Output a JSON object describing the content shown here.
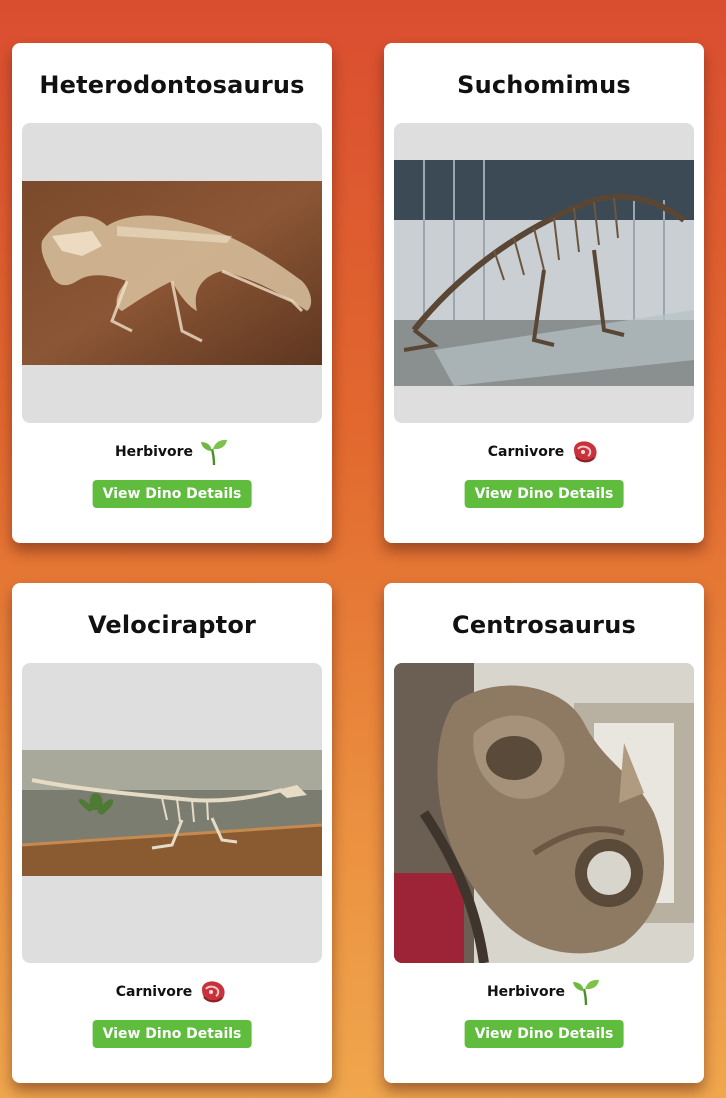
{
  "cards": [
    {
      "name": "Heterodontosaurus",
      "diet": "Herbivore",
      "diet_icon": "seedling-icon",
      "button_label": "View Dino Details",
      "photo": "fossil skeleton embedded in brown rock slab"
    },
    {
      "name": "Suchomimus",
      "diet": "Carnivore",
      "diet_icon": "meat-icon",
      "button_label": "View Dino Details",
      "photo": "mounted skeleton in glass museum atrium"
    },
    {
      "name": "Velociraptor",
      "diet": "Carnivore",
      "diet_icon": "meat-icon",
      "button_label": "View Dino Details",
      "photo": "skeleton on wooden display table"
    },
    {
      "name": "Centrosaurus",
      "diet": "Herbivore",
      "diet_icon": "seedling-icon",
      "button_label": "View Dino Details",
      "photo": "horned skull fossil close-up in museum"
    }
  ],
  "colors": {
    "button": "#5fbc3d",
    "card": "#ffffff",
    "media_placeholder": "#dedede",
    "background_top": "#da4e30",
    "background_bottom": "#f0a64d"
  }
}
